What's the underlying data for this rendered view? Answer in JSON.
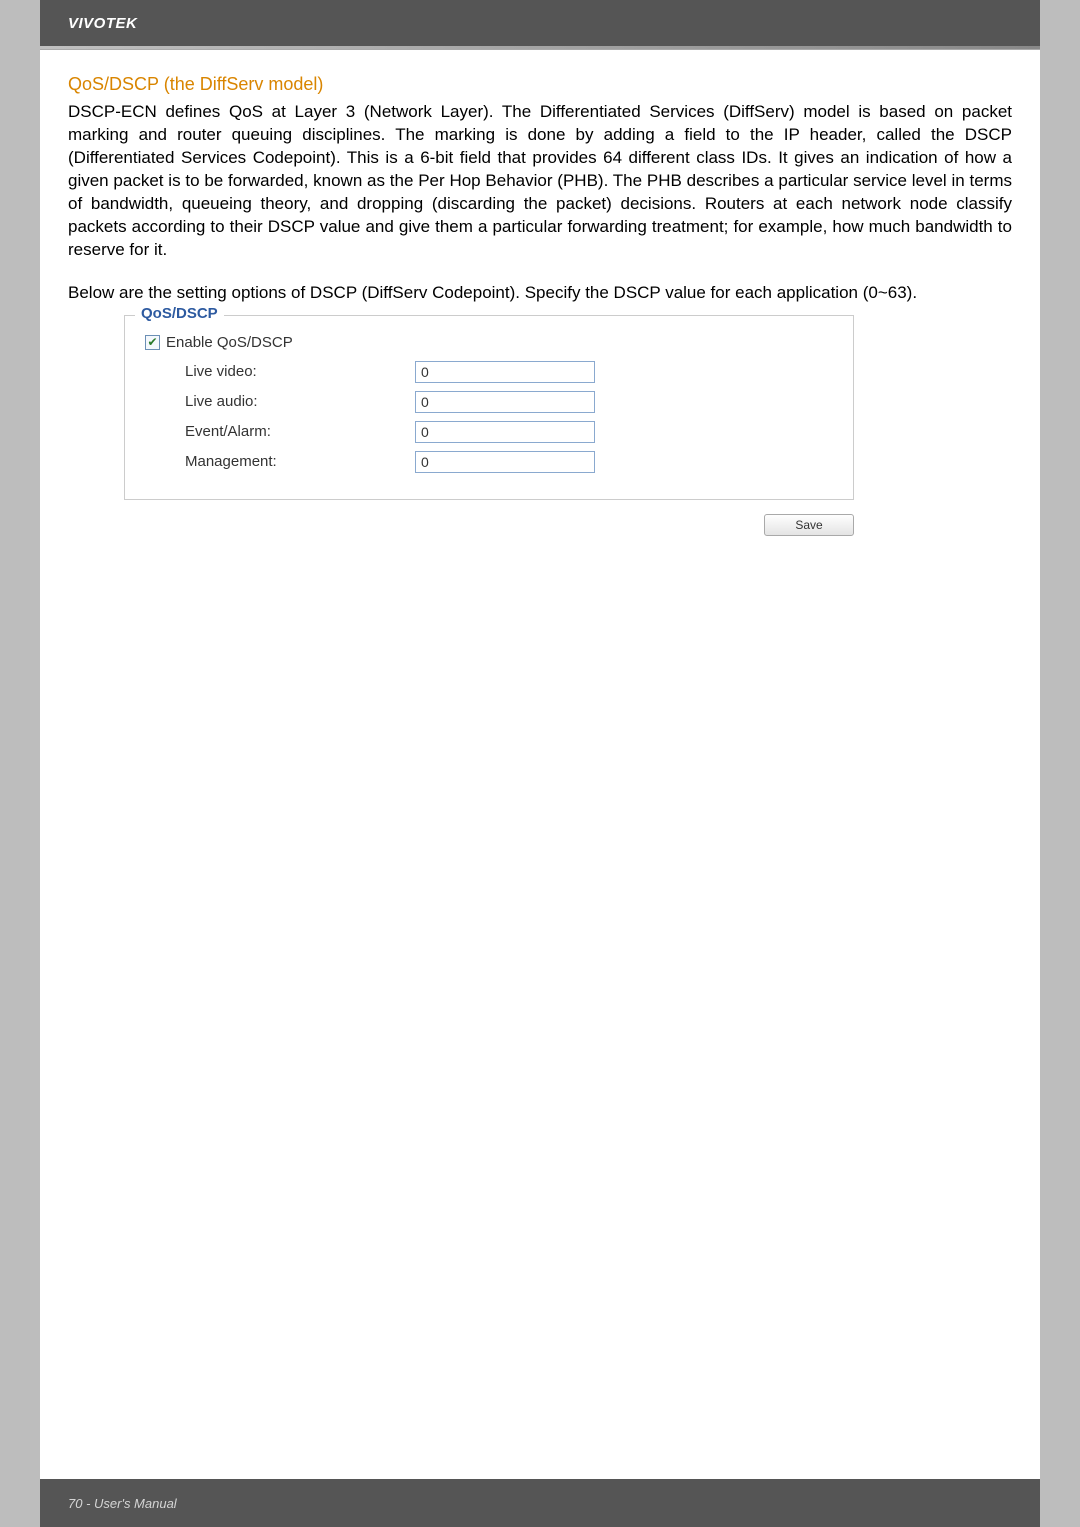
{
  "header": {
    "brand": "VIVOTEK"
  },
  "section": {
    "title": "QoS/DSCP (the DiffServ model)",
    "para1": "DSCP-ECN defines QoS at Layer 3 (Network Layer). The Differentiated Services (DiffServ) model is based on packet marking and router queuing disciplines. The marking is done by adding a field to the IP header, called the DSCP (Differentiated Services Codepoint). This is a 6-bit field that provides 64 different class IDs. It gives an indication of how a given packet is to be forwarded, known as the Per Hop Behavior (PHB). The PHB describes a particular service level in terms of bandwidth, queueing theory, and dropping (discarding the packet) decisions. Routers at each network node classify packets according to their DSCP value and give them a particular forwarding treatment; for example, how much bandwidth to reserve for it.",
    "para2": "Below are the setting options of DSCP (DiffServ Codepoint). Specify the DSCP value for each application (0~63)."
  },
  "form": {
    "legend": "QoS/DSCP",
    "enable_label": "Enable QoS/DSCP",
    "enable_checked": true,
    "rows": {
      "live_video": {
        "label": "Live video:",
        "value": "0"
      },
      "live_audio": {
        "label": "Live audio:",
        "value": "0"
      },
      "event_alarm": {
        "label": "Event/Alarm:",
        "value": "0"
      },
      "management": {
        "label": "Management:",
        "value": "0"
      }
    },
    "save_label": "Save"
  },
  "footer": {
    "text": "70 - User's Manual"
  }
}
